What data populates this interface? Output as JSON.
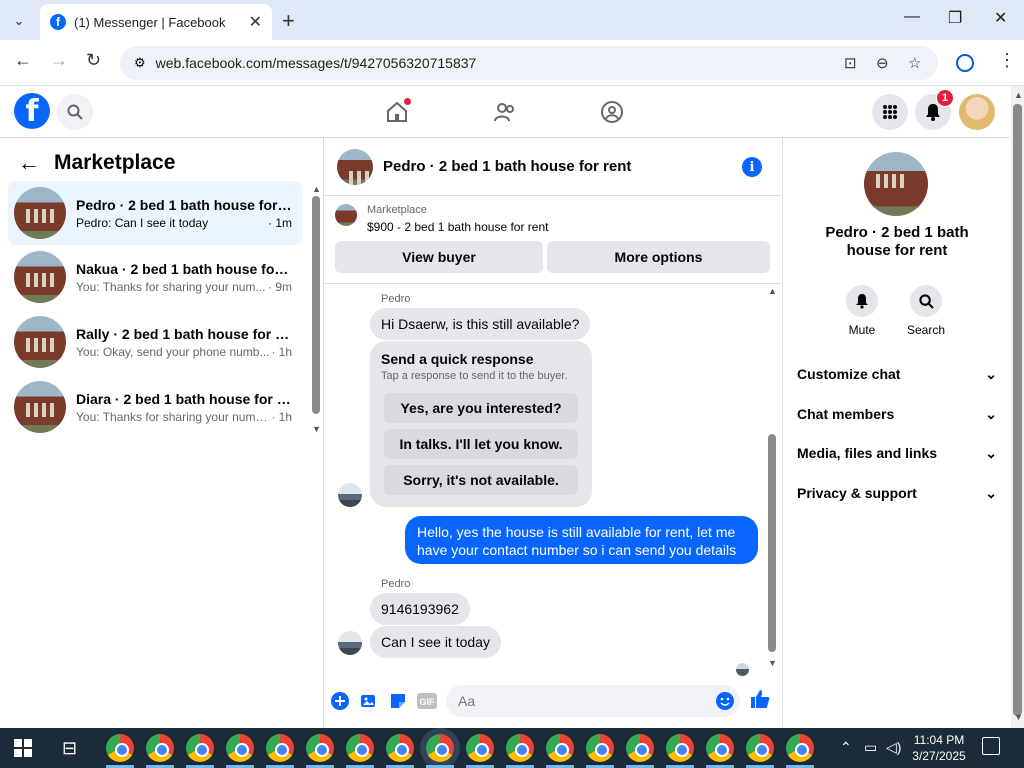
{
  "browser": {
    "tab_title": "(1) Messenger | Facebook",
    "url": "web.facebook.com/messages/t/9427056320715837"
  },
  "facebook": {
    "notification_count": "1"
  },
  "left_pane": {
    "title": "Marketplace",
    "conversations": [
      {
        "name": "Pedro · 2 bed 1 bath house for r...",
        "preview": "Pedro: Can I see it today",
        "time": "· 1m",
        "selected": true
      },
      {
        "name": "Nakua · 2 bed 1 bath house for r...",
        "preview": "You: Thanks for sharing your num...",
        "time": "· 9m",
        "selected": false
      },
      {
        "name": "Rally · 2 bed 1 bath house for rent",
        "preview": "You: Okay, send your phone numb...",
        "time": "· 1h",
        "selected": false
      },
      {
        "name": "Diara · 2 bed 1 bath house for re...",
        "preview": "You: Thanks for sharing your numb...",
        "time": "· 1h",
        "selected": false
      }
    ]
  },
  "chat": {
    "title": "Pedro · 2 bed 1 bath house for rent",
    "marketplace_label": "Marketplace",
    "listing": "$900 - 2 bed 1 bath house for rent",
    "view_buyer": "View buyer",
    "more_options": "More options",
    "sender_name": "Pedro",
    "msg1": "Hi Dsaerw, is this still available?",
    "quick_title": "Send a quick response",
    "quick_sub": "Tap a response to send it to the buyer.",
    "quick_options": [
      "Yes, are you interested?",
      "In talks. I'll let you know.",
      "Sorry, it's not available."
    ],
    "my_msg": "Hello, yes the house is still available for rent, let me have your contact number so i can send you  details",
    "msg2": "9146193962",
    "msg3": "Can I see it today",
    "input_placeholder": "Aa"
  },
  "right_pane": {
    "name": "Pedro · 2 bed 1 bath house for rent",
    "mute": "Mute",
    "search": "Search",
    "sections": [
      "Customize chat",
      "Chat members",
      "Media, files and links",
      "Privacy & support"
    ]
  },
  "taskbar": {
    "time": "11:04 PM",
    "date": "3/27/2025"
  }
}
